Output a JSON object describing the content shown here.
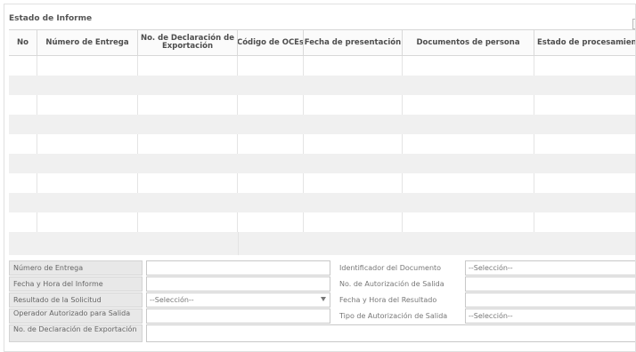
{
  "panel": {
    "title": "Estado de Informe"
  },
  "grid": {
    "columns": [
      "No",
      "Número de Entrega",
      "No. de Declaración de Exportación",
      "Código de OCEs",
      "Fecha de presentación",
      "Documentos de persona",
      "Estado de procesamiento"
    ]
  },
  "form": {
    "numero_entrega": {
      "label": "Número de Entrega",
      "value": ""
    },
    "identificador_documento": {
      "label": "Identificador del Documento",
      "value": "--Selección--"
    },
    "fecha_hora_informe": {
      "label": "Fecha y Hora del Informe",
      "value": ""
    },
    "no_autorizacion_salida": {
      "label": "No. de Autorización de Salida",
      "value": ""
    },
    "resultado_solicitud": {
      "label": "Resultado de la Solicitud",
      "value": "--Selección--"
    },
    "fecha_hora_resultado": {
      "label": "Fecha y Hora del Resultado",
      "value": ""
    },
    "operador_autorizado": {
      "label": "Operador Autorizado para Salida",
      "value": ""
    },
    "tipo_autorizacion_salida": {
      "label": "Tipo de Autorización de Salida",
      "value": "--Selección--"
    },
    "no_declaracion_exportacion": {
      "label": "No. de Declaración de Exportación",
      "value": ""
    }
  }
}
